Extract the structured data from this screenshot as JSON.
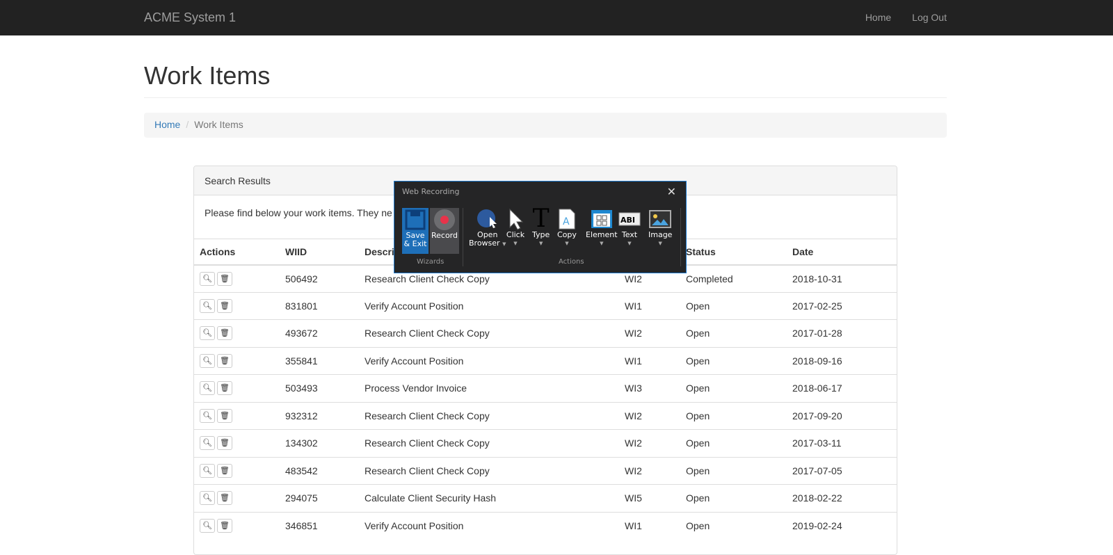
{
  "nav": {
    "brand": "ACME System 1",
    "links": [
      "Home",
      "Log Out"
    ]
  },
  "page": {
    "title": "Work Items"
  },
  "breadcrumb": {
    "home": "Home",
    "current": "Work Items"
  },
  "panel": {
    "heading": "Search Results",
    "intro": "Please find below your work items. They ne"
  },
  "table": {
    "headers": [
      "Actions",
      "WIID",
      "Description",
      "",
      "Status",
      "Date"
    ],
    "rows": [
      [
        "506492",
        "Research Client Check Copy",
        "WI2",
        "Completed",
        "2018-10-31"
      ],
      [
        "831801",
        "Verify Account Position",
        "WI1",
        "Open",
        "2017-02-25"
      ],
      [
        "493672",
        "Research Client Check Copy",
        "WI2",
        "Open",
        "2017-01-28"
      ],
      [
        "355841",
        "Verify Account Position",
        "WI1",
        "Open",
        "2018-09-16"
      ],
      [
        "503493",
        "Process Vendor Invoice",
        "WI3",
        "Open",
        "2018-06-17"
      ],
      [
        "932312",
        "Research Client Check Copy",
        "WI2",
        "Open",
        "2017-09-20"
      ],
      [
        "134302",
        "Research Client Check Copy",
        "WI2",
        "Open",
        "2017-03-11"
      ],
      [
        "483542",
        "Research Client Check Copy",
        "WI2",
        "Open",
        "2017-07-05"
      ],
      [
        "294075",
        "Calculate Client Security Hash",
        "WI5",
        "Open",
        "2018-02-22"
      ],
      [
        "346851",
        "Verify Account Position",
        "WI1",
        "Open",
        "2019-02-24"
      ]
    ]
  },
  "recorder": {
    "title": "Web Recording",
    "save": "Save & Exit",
    "record": "Record",
    "wizards": "Wizards",
    "actions": "Actions",
    "tools": [
      {
        "l1": "Open",
        "l2": "Browser"
      },
      {
        "l1": "Click"
      },
      {
        "l1": "Type"
      },
      {
        "l1": "Copy"
      },
      {
        "l1": "Element"
      },
      {
        "l1": "Text"
      },
      {
        "l1": "Image"
      }
    ],
    "colors": {
      "save": "#1e6fb8",
      "record_dot": "#e8334a",
      "border": "#1e7bd0"
    }
  }
}
